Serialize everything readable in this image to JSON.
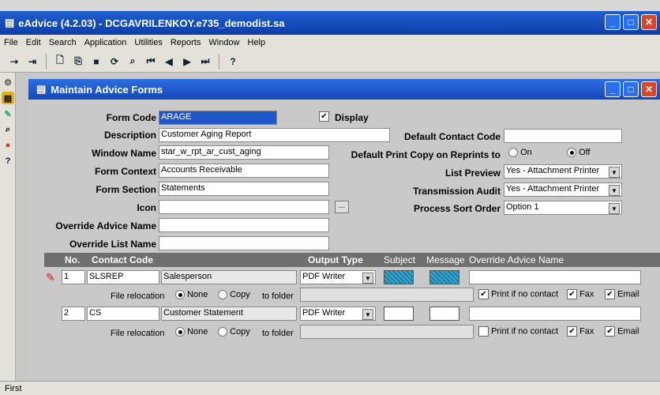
{
  "app": {
    "title": "eAdvice (4.2.03) - DCGAVRILENKOY.e735_demodist.sa"
  },
  "menu": [
    "File",
    "Edit",
    "Search",
    "Application",
    "Utilities",
    "Reports",
    "Window",
    "Help"
  ],
  "inner": {
    "title": "Maintain Advice Forms"
  },
  "form": {
    "form_code_label": "Form Code",
    "form_code": "ARAGE",
    "display_label": "Display",
    "description_label": "Description",
    "description": "Customer Aging Report",
    "window_name_label": "Window Name",
    "window_name": "star_w_rpt_ar_cust_aging",
    "form_context_label": "Form Context",
    "form_context": "Accounts Receivable",
    "form_section_label": "Form Section",
    "form_section": "Statements",
    "icon_label": "Icon",
    "icon_browse": "...",
    "override_advice_label": "Override Advice Name",
    "override_list_label": "Override List Name",
    "default_contact_label": "Default Contact Code",
    "print_copy_label": "Default Print Copy on Reprints to",
    "on_label": "On",
    "off_label": "Off",
    "list_preview_label": "List Preview",
    "list_preview": "Yes - Attachment Printer",
    "transmission_label": "Transmission Audit",
    "transmission": "Yes - Attachment Printer",
    "sort_label": "Process Sort Order",
    "sort": "Option 1"
  },
  "grid": {
    "headers": {
      "no": "No.",
      "contact": "Contact Code",
      "output": "Output Type",
      "subject": "Subject",
      "message": "Message",
      "override": "Override Advice Name"
    },
    "rows": [
      {
        "no": "1",
        "code": "SLSREP",
        "name": "Salesperson",
        "output": "PDF Writer"
      },
      {
        "no": "2",
        "code": "CS",
        "name": "Customer Statement",
        "output": "PDF Writer"
      }
    ],
    "reloc_label": "File relocation",
    "none_label": "None",
    "copy_label": "Copy",
    "to_folder_label": "to folder",
    "print_if_label": "Print if no contact",
    "fax_label": "Fax",
    "email_label": "Email"
  },
  "status": {
    "text": "First"
  }
}
